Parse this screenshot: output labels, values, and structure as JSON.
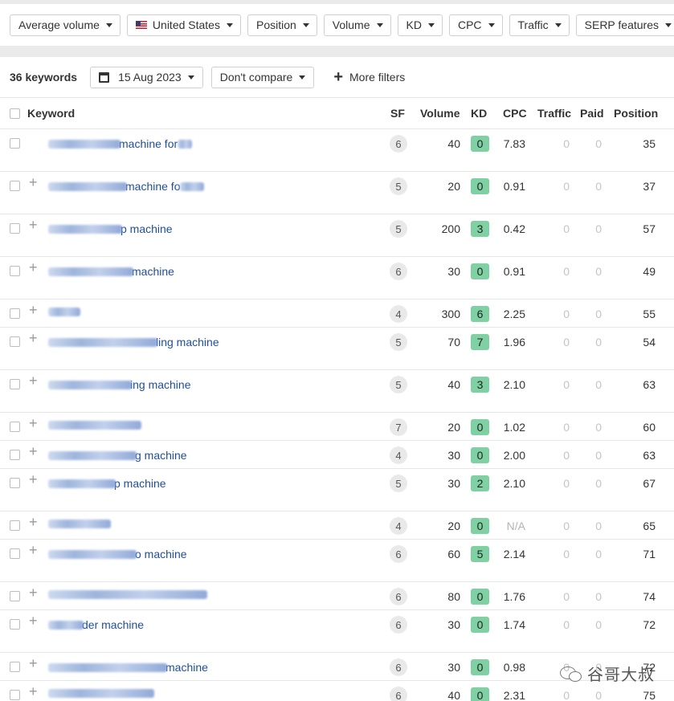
{
  "filters": [
    {
      "label": "Average volume",
      "flag": false
    },
    {
      "label": "United States",
      "flag": true
    },
    {
      "label": "Position",
      "flag": false
    },
    {
      "label": "Volume",
      "flag": false
    },
    {
      "label": "KD",
      "flag": false
    },
    {
      "label": "CPC",
      "flag": false
    },
    {
      "label": "Traffic",
      "flag": false
    },
    {
      "label": "SERP features",
      "flag": false
    }
  ],
  "toolbar": {
    "keyword_count": "36 keywords",
    "date_label": "15 Aug 2023",
    "compare_label": "Don't compare",
    "more_filters_label": "More filters"
  },
  "table": {
    "headers": {
      "keyword": "Keyword",
      "sf": "SF",
      "volume": "Volume",
      "kd": "KD",
      "cpc": "CPC",
      "traffic": "Traffic",
      "paid": "Paid",
      "position": "Position"
    },
    "rows": [
      {
        "kw": "machine for",
        "sf": "6",
        "volume": "40",
        "kd": "0",
        "cpc": "7.83",
        "traffic": "0",
        "paid": "0",
        "position": "35",
        "h": 53,
        "plus": false,
        "pre": 90,
        "post": 18
      },
      {
        "kw": "machine fo",
        "sf": "5",
        "volume": "20",
        "kd": "0",
        "cpc": "0.91",
        "traffic": "0",
        "paid": "0",
        "position": "37",
        "h": 53,
        "plus": true,
        "pre": 98,
        "post": 30
      },
      {
        "kw": "p machine",
        "sf": "5",
        "volume": "200",
        "kd": "3",
        "cpc": "0.42",
        "traffic": "0",
        "paid": "0",
        "position": "57",
        "h": 53,
        "plus": true,
        "pre": 92,
        "post": 0
      },
      {
        "kw": "machine",
        "sf": "6",
        "volume": "30",
        "kd": "0",
        "cpc": "0.91",
        "traffic": "0",
        "paid": "0",
        "position": "49",
        "h": 53,
        "plus": true,
        "pre": 106,
        "post": 0
      },
      {
        "kw": "",
        "sf": "4",
        "volume": "300",
        "kd": "6",
        "cpc": "2.25",
        "traffic": "0",
        "paid": "0",
        "position": "55",
        "h": 35,
        "plus": true,
        "pre": 40,
        "post": 0
      },
      {
        "kw": "ling machine",
        "sf": "5",
        "volume": "70",
        "kd": "7",
        "cpc": "1.96",
        "traffic": "0",
        "paid": "0",
        "position": "54",
        "h": 53,
        "plus": true,
        "pre": 136,
        "post": 0
      },
      {
        "kw": "ing machine",
        "sf": "5",
        "volume": "40",
        "kd": "3",
        "cpc": "2.10",
        "traffic": "0",
        "paid": "0",
        "position": "63",
        "h": 53,
        "plus": true,
        "pre": 104,
        "post": 0
      },
      {
        "kw": "",
        "sf": "7",
        "volume": "20",
        "kd": "0",
        "cpc": "1.02",
        "traffic": "0",
        "paid": "0",
        "position": "60",
        "h": 35,
        "plus": true,
        "pre": 116,
        "post": 0
      },
      {
        "kw": "g machine",
        "sf": "4",
        "volume": "30",
        "kd": "0",
        "cpc": "2.00",
        "traffic": "0",
        "paid": "0",
        "position": "63",
        "h": 35,
        "plus": true,
        "pre": 110,
        "post": 0
      },
      {
        "kw": "p machine",
        "sf": "5",
        "volume": "30",
        "kd": "2",
        "cpc": "2.10",
        "traffic": "0",
        "paid": "0",
        "position": "67",
        "h": 53,
        "plus": true,
        "pre": 84,
        "post": 0
      },
      {
        "kw": "",
        "sf": "4",
        "volume": "20",
        "kd": "0",
        "cpc": "N/A",
        "traffic": "0",
        "paid": "0",
        "position": "65",
        "h": 35,
        "plus": true,
        "pre": 78,
        "post": 0
      },
      {
        "kw": "o machine",
        "sf": "6",
        "volume": "60",
        "kd": "5",
        "cpc": "2.14",
        "traffic": "0",
        "paid": "0",
        "position": "71",
        "h": 53,
        "plus": true,
        "pre": 110,
        "post": 0
      },
      {
        "kw": "",
        "sf": "6",
        "volume": "80",
        "kd": "0",
        "cpc": "1.76",
        "traffic": "0",
        "paid": "0",
        "position": "74",
        "h": 35,
        "plus": true,
        "pre": 198,
        "post": 0
      },
      {
        "kw": "der machine",
        "sf": "6",
        "volume": "30",
        "kd": "0",
        "cpc": "1.74",
        "traffic": "0",
        "paid": "0",
        "position": "72",
        "h": 53,
        "plus": true,
        "pre": 44,
        "post": 0
      },
      {
        "kw": "machine",
        "sf": "6",
        "volume": "30",
        "kd": "0",
        "cpc": "0.98",
        "traffic": "0",
        "paid": "0",
        "position": "72",
        "h": 35,
        "plus": true,
        "pre": 148,
        "post": 0
      },
      {
        "kw": "",
        "sf": "6",
        "volume": "40",
        "kd": "0",
        "cpc": "2.31",
        "traffic": "0",
        "paid": "0",
        "position": "75",
        "h": 35,
        "plus": true,
        "pre": 132,
        "post": 0
      }
    ]
  },
  "kd_colors": {
    "0": "#7fd1a4",
    "2": "#7fd1a4",
    "3": "#7fd1a4",
    "5": "#7fd1a4",
    "6": "#7fd1a4",
    "7": "#7fd1a4"
  },
  "watermark": {
    "text": "谷哥大叔",
    "icon": "wechat-icon"
  }
}
